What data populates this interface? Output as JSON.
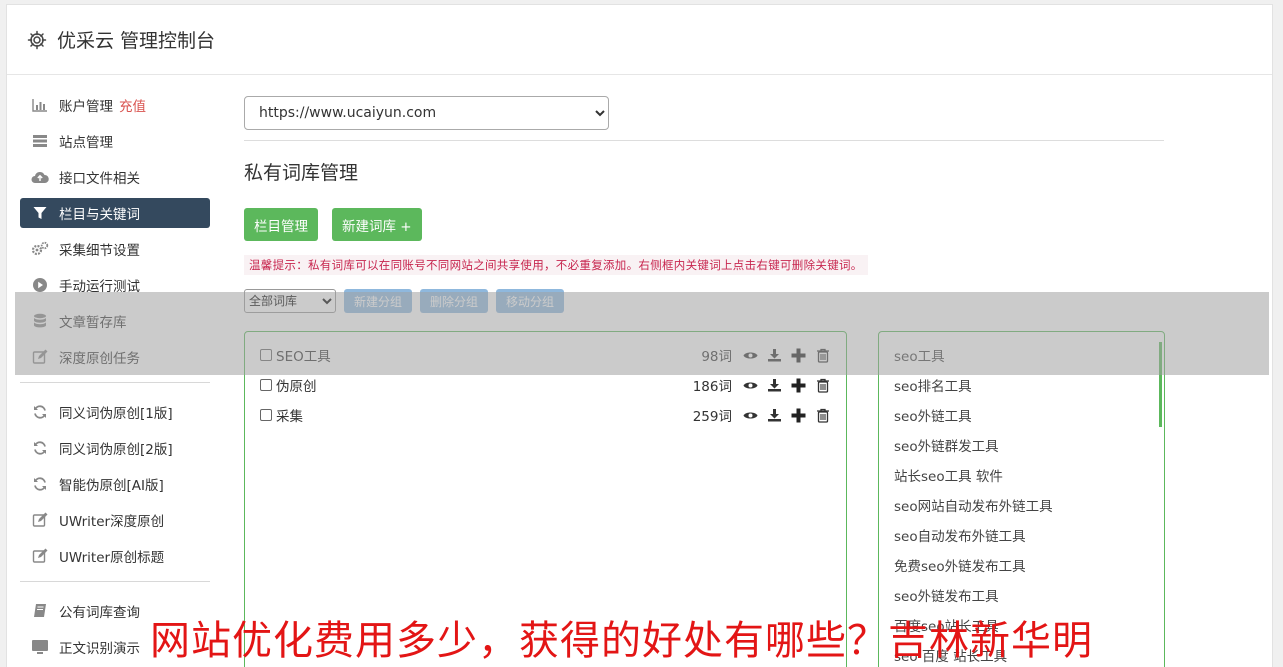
{
  "header": {
    "title": "优采云 管理控制台"
  },
  "sidebar": {
    "group1": [
      {
        "label": "账户管理",
        "tag": "充值",
        "icon": "bar-chart-icon"
      },
      {
        "label": "站点管理",
        "icon": "server-icon"
      },
      {
        "label": "接口文件相关",
        "icon": "cloud-upload-icon"
      },
      {
        "label": "栏目与关键词",
        "icon": "filter-icon",
        "active": true
      },
      {
        "label": "采集细节设置",
        "icon": "gears-icon"
      },
      {
        "label": "手动运行测试",
        "icon": "play-circle-icon"
      },
      {
        "label": "文章暂存库",
        "icon": "database-icon"
      },
      {
        "label": "深度原创任务",
        "icon": "edit-icon"
      }
    ],
    "group2": [
      {
        "label": "同义词伪原创[1版]",
        "icon": "refresh-icon"
      },
      {
        "label": "同义词伪原创[2版]",
        "icon": "refresh-icon"
      },
      {
        "label": "智能伪原创[AI版]",
        "icon": "refresh-icon"
      },
      {
        "label": "UWriter深度原创",
        "icon": "edit-icon"
      },
      {
        "label": "UWriter原创标题",
        "icon": "edit-icon"
      }
    ],
    "group3": [
      {
        "label": "公有词库查询",
        "icon": "book-icon"
      },
      {
        "label": "正文识别演示",
        "icon": "monitor-icon"
      }
    ]
  },
  "main": {
    "site_select": "https://www.ucaiyun.com",
    "page_title": "私有词库管理",
    "btn_columns": "栏目管理",
    "btn_new_lib": "新建词库 +",
    "tip": "温馨提示：私有词库可以在同账号不同网站之间共享使用，不必重复添加。右侧框内关键词上点击右键可删除关键词。",
    "group_select": "全部词库",
    "btn_new_group": "新建分组",
    "btn_del_group": "删除分组",
    "btn_move_group": "移动分组",
    "libraries": [
      {
        "name": "SEO工具",
        "count": "98词"
      },
      {
        "name": "伪原创",
        "count": "186词"
      },
      {
        "name": "采集",
        "count": "259词"
      }
    ],
    "keywords": [
      "seo工具",
      "seo排名工具",
      "seo外链工具",
      "seo外链群发工具",
      "站长seo工具 软件",
      "seo网站自动发布外链工具",
      "seo自动发布外链工具",
      "免费seo外链发布工具",
      "seo外链发布工具",
      "百度seo站长工具",
      "seo 百度 站长工具"
    ]
  },
  "banner": "网站优化费用多少，获得的好处有哪些？吉林新华明",
  "colors": {
    "green": "#5cb85c",
    "nav_active": "#34495e",
    "tip_red": "#c7254e",
    "banner_red": "#e31515"
  }
}
